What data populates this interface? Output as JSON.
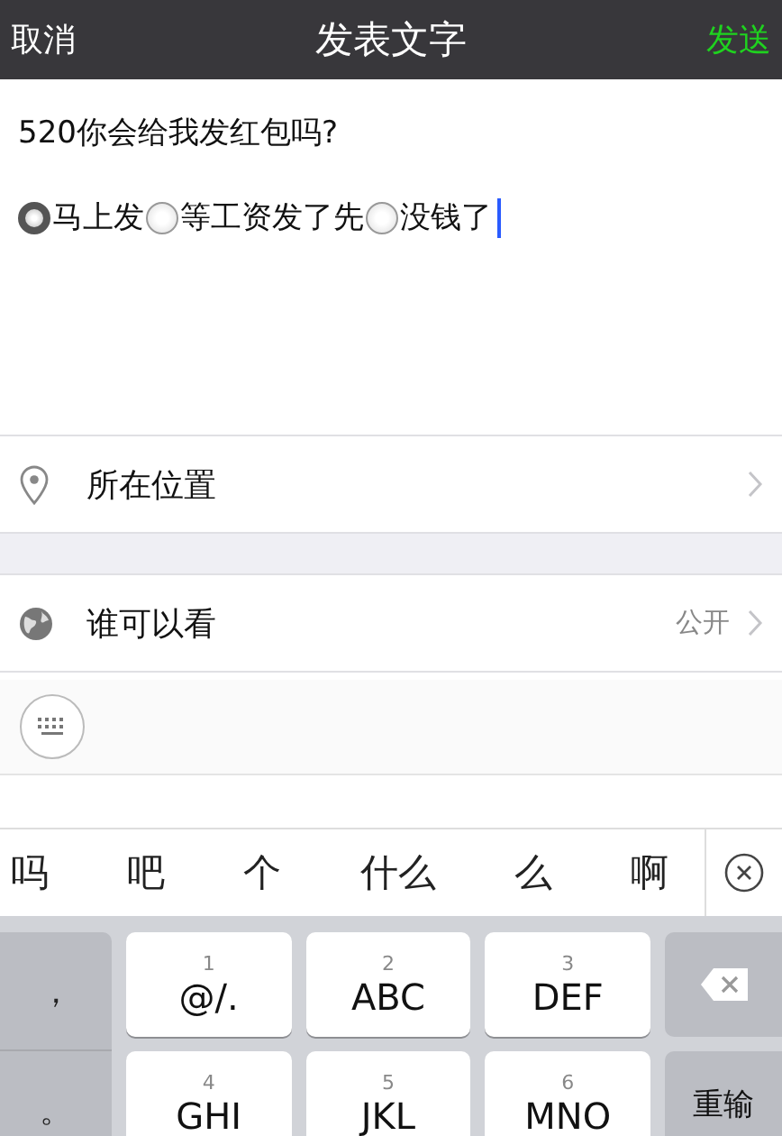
{
  "nav": {
    "cancel": "取消",
    "title": "发表文字",
    "send": "发送"
  },
  "post": {
    "question": "520你会给我发红包吗?",
    "options": [
      {
        "label": "马上发",
        "selected": true
      },
      {
        "label": "等工资发了先",
        "selected": false
      },
      {
        "label": "没钱了",
        "selected": false
      }
    ]
  },
  "rows": [
    {
      "kind": "location",
      "label": "所在位置"
    },
    {
      "kind": "visibility",
      "label": "谁可以看",
      "value": "公开"
    }
  ],
  "candidates": [
    "吗",
    "吧",
    "个",
    "什么",
    "么",
    "啊"
  ],
  "keyboard": {
    "side_keys": [
      "，",
      "。"
    ],
    "keys": [
      {
        "digit": "1",
        "letters": "@/."
      },
      {
        "digit": "2",
        "letters": "ABC"
      },
      {
        "digit": "3",
        "letters": "DEF"
      },
      {
        "digit": "4",
        "letters": "GHI"
      },
      {
        "digit": "5",
        "letters": "JKL"
      },
      {
        "digit": "6",
        "letters": "MNO"
      }
    ],
    "reset": "重输"
  }
}
